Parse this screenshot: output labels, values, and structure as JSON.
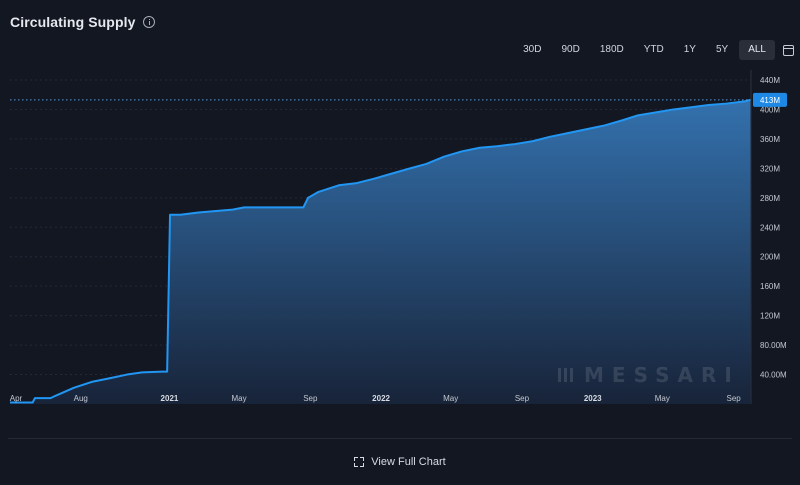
{
  "widget": {
    "title": "Circulating Supply",
    "info_icon": "info-icon",
    "ranges": [
      {
        "label": "30D",
        "active": false
      },
      {
        "label": "90D",
        "active": false
      },
      {
        "label": "180D",
        "active": false
      },
      {
        "label": "YTD",
        "active": false
      },
      {
        "label": "1Y",
        "active": false
      },
      {
        "label": "5Y",
        "active": false
      },
      {
        "label": "ALL",
        "active": true
      }
    ],
    "calendar_icon": "calendar-icon",
    "watermark_text": "MESSARI",
    "footer": {
      "link_label": "View Full Chart",
      "icon": "expand-icon"
    },
    "colors": {
      "background": "#131722",
      "line": "#2196f3",
      "area_top": "#3576b5",
      "area_bottom": "#18243a",
      "last_value_badge": "#1e88e5"
    }
  },
  "chart_data": {
    "type": "area",
    "title": "Circulating Supply",
    "xlabel": "",
    "ylabel": "",
    "last_value_label": "413M",
    "last_value": 413,
    "ylim": [
      0,
      440
    ],
    "y_ticks": [
      40,
      80,
      120,
      160,
      200,
      240,
      280,
      320,
      360,
      400,
      440
    ],
    "y_tick_labels": [
      "40.00M",
      "80.00M",
      "120M",
      "160M",
      "200M",
      "240M",
      "280M",
      "320M",
      "360M",
      "400M",
      "440M"
    ],
    "x_ticks": [
      {
        "date": "2020-04-01",
        "label": "Apr",
        "bold": false
      },
      {
        "date": "2020-08-01",
        "label": "Aug",
        "bold": false
      },
      {
        "date": "2021-01-01",
        "label": "2021",
        "bold": true
      },
      {
        "date": "2021-05-01",
        "label": "May",
        "bold": false
      },
      {
        "date": "2021-09-01",
        "label": "Sep",
        "bold": false
      },
      {
        "date": "2022-01-01",
        "label": "2022",
        "bold": true
      },
      {
        "date": "2022-05-01",
        "label": "May",
        "bold": false
      },
      {
        "date": "2022-09-01",
        "label": "Sep",
        "bold": false
      },
      {
        "date": "2023-01-01",
        "label": "2023",
        "bold": true
      },
      {
        "date": "2023-05-01",
        "label": "May",
        "bold": false
      },
      {
        "date": "2023-09-01",
        "label": "Sep",
        "bold": false
      }
    ],
    "xlim": [
      "2020-04-01",
      "2023-10-01"
    ],
    "series": [
      {
        "name": "",
        "x": [
          "2020-04-01",
          "2020-05-10",
          "2020-05-14",
          "2020-06-10",
          "2020-06-18",
          "2020-07-20",
          "2020-08-20",
          "2020-09-20",
          "2020-10-20",
          "2020-11-15",
          "2020-12-20",
          "2020-12-28",
          "2021-01-02",
          "2021-01-20",
          "2021-02-20",
          "2021-03-20",
          "2021-04-20",
          "2021-05-10",
          "2021-06-10",
          "2021-07-10",
          "2021-08-10",
          "2021-08-20",
          "2021-08-28",
          "2021-09-15",
          "2021-10-20",
          "2021-11-20",
          "2021-12-20",
          "2022-01-20",
          "2022-02-20",
          "2022-03-20",
          "2022-04-20",
          "2022-05-20",
          "2022-06-20",
          "2022-07-20",
          "2022-08-20",
          "2022-09-20",
          "2022-10-20",
          "2022-11-20",
          "2022-12-20",
          "2023-01-20",
          "2023-02-20",
          "2023-03-20",
          "2023-04-20",
          "2023-05-20",
          "2023-06-20",
          "2023-07-20",
          "2023-08-20",
          "2023-09-20",
          "2023-09-30"
        ],
        "values": [
          2,
          2,
          8,
          8,
          11,
          22,
          30,
          35,
          40,
          43,
          44,
          44,
          257,
          257,
          260,
          262,
          264,
          267,
          267,
          267,
          267,
          267,
          280,
          288,
          297,
          300,
          306,
          313,
          320,
          326,
          336,
          343,
          348,
          350,
          353,
          357,
          363,
          368,
          373,
          378,
          385,
          392,
          396,
          400,
          403,
          406,
          408,
          411,
          413
        ]
      }
    ]
  }
}
